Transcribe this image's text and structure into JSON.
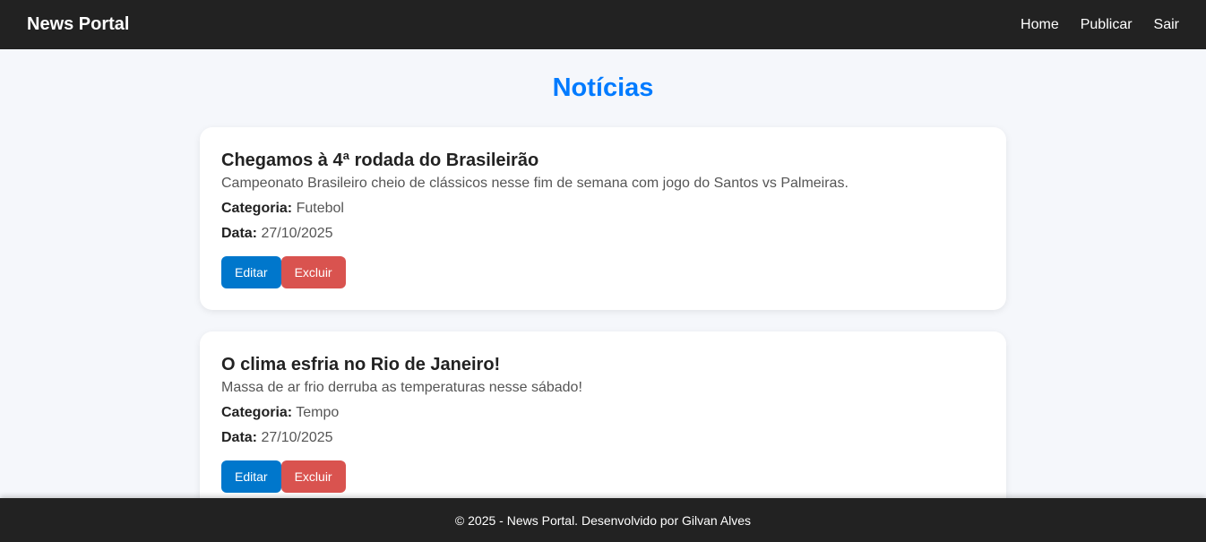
{
  "header": {
    "brand": "News Portal",
    "nav": [
      "Home",
      "Publicar",
      "Sair"
    ]
  },
  "page_title": "Notícias",
  "labels": {
    "category": "Categoria:",
    "date": "Data:",
    "edit": "Editar",
    "delete": "Excluir"
  },
  "news": [
    {
      "title": "Chegamos à 4ª rodada do Brasileirão",
      "description": "Campeonato Brasileiro cheio de clássicos nesse fim de semana com jogo do Santos vs Palmeiras.",
      "category": "Futebol",
      "date": "27/10/2025"
    },
    {
      "title": "O clima esfria no Rio de Janeiro!",
      "description": "Massa de ar frio derruba as temperaturas nesse sábado!",
      "category": "Tempo",
      "date": "27/10/2025"
    }
  ],
  "footer": "© 2025 - News Portal. Desenvolvido por Gilvan Alves"
}
